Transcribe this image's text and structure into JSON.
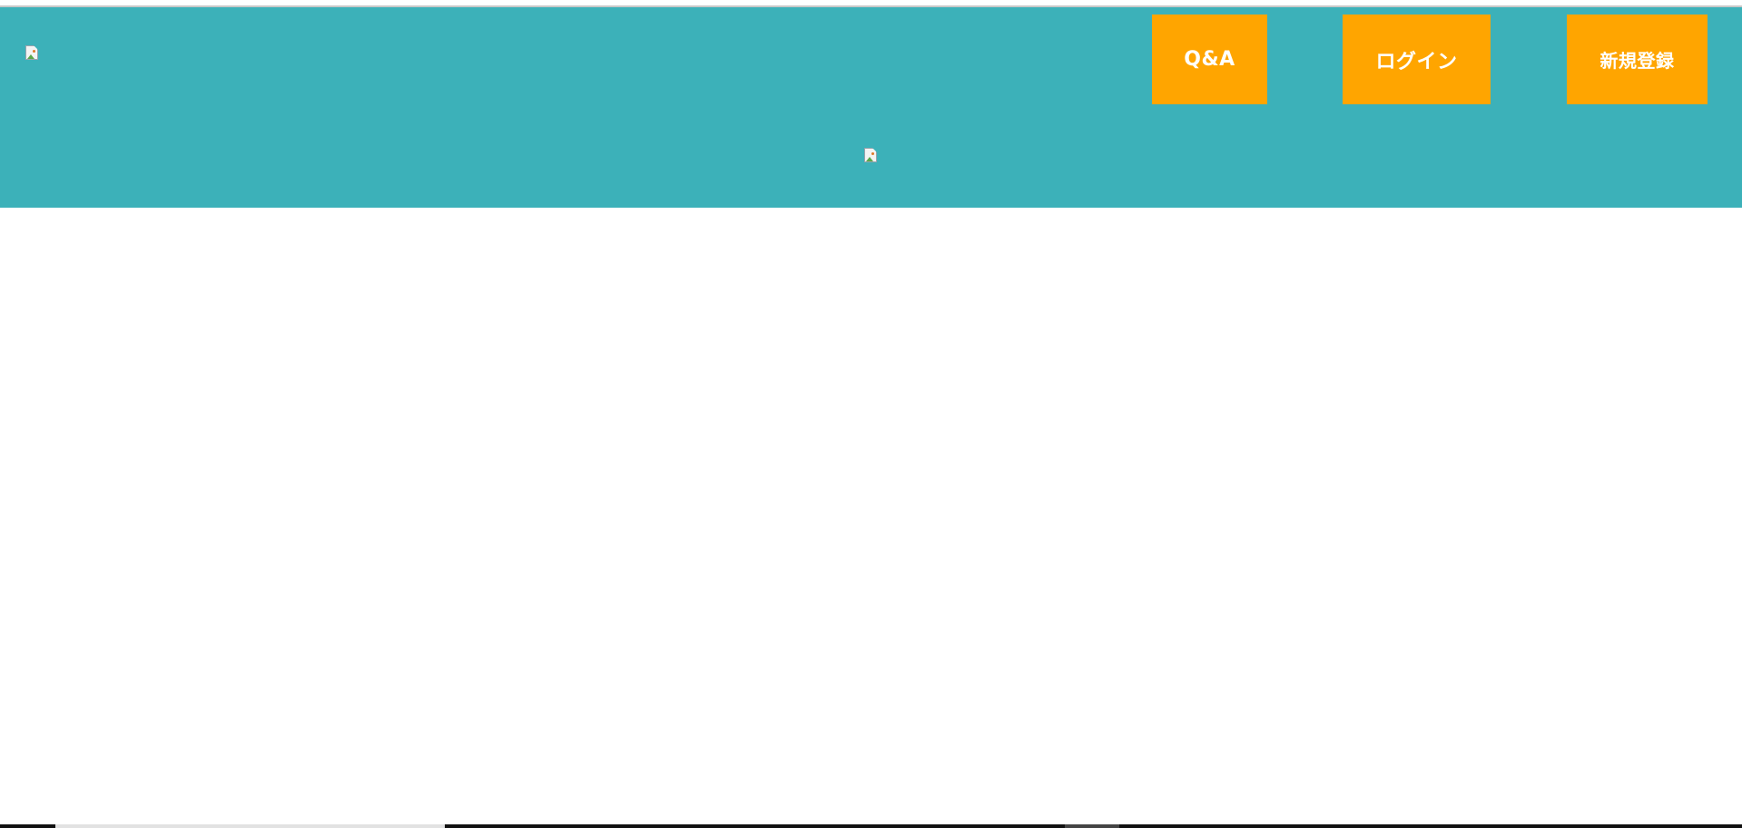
{
  "colors": {
    "header_bg": "#3cb1b9",
    "button_bg": "#ffa500",
    "button_text": "#ffffff",
    "page_bg": "#ffffff"
  },
  "header": {
    "logo_icon": "broken-image-icon",
    "hero_icon": "broken-image-icon"
  },
  "nav": {
    "qa_label": "Q&A",
    "login_label": "ログイン",
    "signup_label": "新規登録"
  }
}
